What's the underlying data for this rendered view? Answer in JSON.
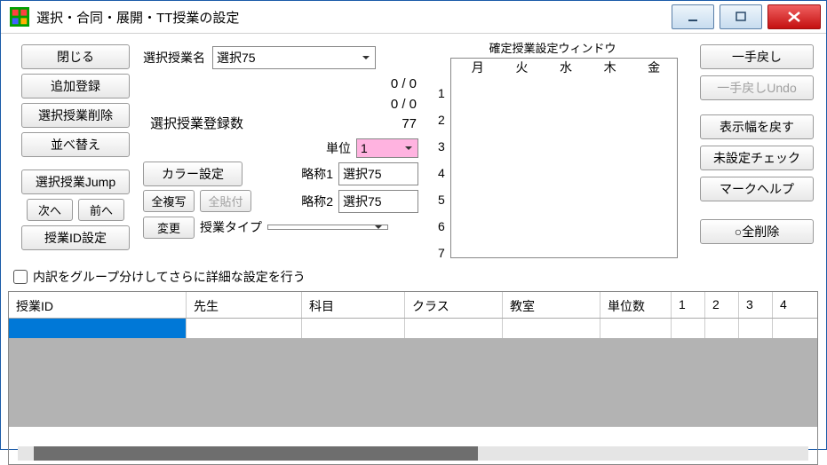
{
  "title": "選択・合同・展開・TT授業の設定",
  "wincontrols": {
    "min": "minimize",
    "max": "maximize",
    "close": "close"
  },
  "left": {
    "close": "閉じる",
    "add": "追加登録",
    "delete": "選択授業削除",
    "sort": "並べ替え",
    "jump": "選択授業Jump",
    "next": "次へ",
    "prev": "前へ",
    "idset": "授業ID設定"
  },
  "mid": {
    "name_label": "選択授業名",
    "name_value": "選択75",
    "stat1": "0 / 0",
    "stat2": "0 / 0",
    "count_label": "選択授業登録数",
    "count_value": "77",
    "unit_label": "単位",
    "unit_value": "1",
    "abbr1_label": "略称1",
    "abbr1_value": "選択75",
    "abbr2_label": "略称2",
    "abbr2_value": "選択75",
    "color_btn": "カラー設定",
    "copyall_btn": "全複写",
    "pasteall_btn": "全貼付",
    "change_btn": "変更",
    "type_label": "授業タイプ",
    "type_value": ""
  },
  "cal": {
    "title": "確定授業設定ウィンドウ",
    "days": [
      "月",
      "火",
      "水",
      "木",
      "金"
    ],
    "periods": [
      "1",
      "2",
      "3",
      "4",
      "5",
      "6",
      "7"
    ]
  },
  "right": {
    "undo": "一手戻し",
    "undo2": "一手戻しUndo",
    "resetw": "表示幅を戻す",
    "check": "未設定チェック",
    "markhelp": "マークヘルプ",
    "delall": "○全削除"
  },
  "chk_label": "内訳をグループ分けしてさらに詳細な設定を行う",
  "grid": {
    "headers": [
      "授業ID",
      "先生",
      "科目",
      "クラス",
      "教室",
      "単位数",
      "1",
      "2",
      "3",
      "4"
    ]
  }
}
